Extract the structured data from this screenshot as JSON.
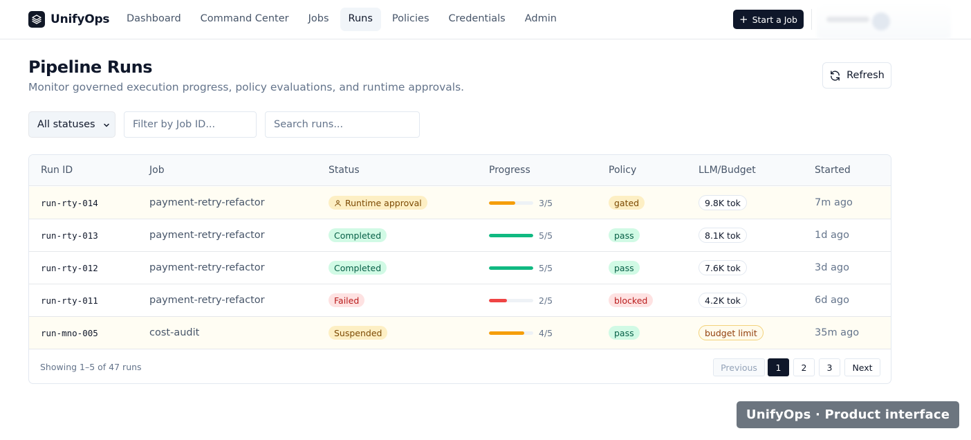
{
  "app": {
    "brand": "UnifyOps",
    "nav": [
      "Dashboard",
      "Command Center",
      "Jobs",
      "Runs",
      "Policies",
      "Credentials",
      "Admin"
    ],
    "active_nav": "Runs",
    "start_job_label": "Start a Job"
  },
  "header": {
    "title": "Pipeline Runs",
    "subtitle": "Monitor governed execution progress, policy evaluations, and runtime approvals.",
    "refresh_label": "Refresh"
  },
  "filters": {
    "status_selected": "All statuses",
    "job_placeholder": "Filter by Job ID...",
    "search_placeholder": "Search runs..."
  },
  "table": {
    "columns": [
      "Run ID",
      "Job",
      "Status",
      "Progress",
      "Policy",
      "LLM/Budget",
      "Started"
    ],
    "rows": [
      {
        "run_id": "run-rty-014",
        "job": "payment-retry-refactor",
        "status": "Runtime approval",
        "status_kind": "approval",
        "progress_done": 3,
        "progress_total": 5,
        "progress_label": "3/5",
        "progress_color": "#f59e0b",
        "policy": "gated",
        "policy_kind": "gated",
        "budget": "9.8K tok",
        "budget_warn": false,
        "started": "7m ago",
        "highlight": true
      },
      {
        "run_id": "run-rty-013",
        "job": "payment-retry-refactor",
        "status": "Completed",
        "status_kind": "completed",
        "progress_done": 5,
        "progress_total": 5,
        "progress_label": "5/5",
        "progress_color": "#10b981",
        "policy": "pass",
        "policy_kind": "pass",
        "budget": "8.1K tok",
        "budget_warn": false,
        "started": "1d ago",
        "highlight": false
      },
      {
        "run_id": "run-rty-012",
        "job": "payment-retry-refactor",
        "status": "Completed",
        "status_kind": "completed",
        "progress_done": 5,
        "progress_total": 5,
        "progress_label": "5/5",
        "progress_color": "#10b981",
        "policy": "pass",
        "policy_kind": "pass",
        "budget": "7.6K tok",
        "budget_warn": false,
        "started": "3d ago",
        "highlight": false
      },
      {
        "run_id": "run-rty-011",
        "job": "payment-retry-refactor",
        "status": "Failed",
        "status_kind": "failed",
        "progress_done": 2,
        "progress_total": 5,
        "progress_label": "2/5",
        "progress_color": "#ef4444",
        "policy": "blocked",
        "policy_kind": "blocked",
        "budget": "4.2K tok",
        "budget_warn": false,
        "started": "6d ago",
        "highlight": false
      },
      {
        "run_id": "run-mno-005",
        "job": "cost-audit",
        "status": "Suspended",
        "status_kind": "suspended",
        "progress_done": 4,
        "progress_total": 5,
        "progress_label": "4/5",
        "progress_color": "#f59e0b",
        "policy": "pass",
        "policy_kind": "pass",
        "budget": "budget limit",
        "budget_warn": true,
        "started": "35m ago",
        "highlight": true
      }
    ],
    "showing": "Showing 1–5 of 47 runs",
    "pagination": {
      "previous": "Previous",
      "pages": [
        "1",
        "2",
        "3"
      ],
      "current": "1",
      "next": "Next"
    }
  },
  "watermark": "UnifyOps · Product interface",
  "icons": {
    "brand": "layers-icon",
    "start": "plus-icon",
    "refresh": "refresh-icon",
    "select": "chevron-down-icon",
    "approval": "user-icon"
  }
}
